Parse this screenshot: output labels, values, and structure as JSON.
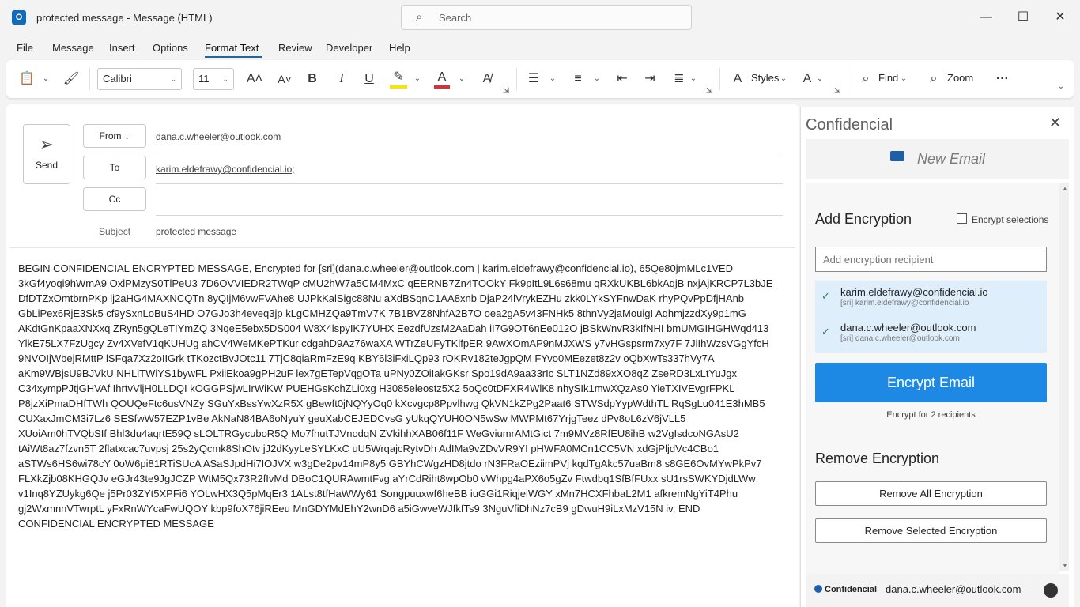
{
  "window": {
    "app_icon": "O",
    "title": "protected message  -  Message (HTML)",
    "search_placeholder": "Search",
    "minimize": "—",
    "maximize": "☐",
    "close": "✕"
  },
  "menu": {
    "items": [
      "File",
      "Message",
      "Insert",
      "Options",
      "Format Text",
      "Review",
      "Developer",
      "Help"
    ],
    "active": "Format Text"
  },
  "ribbon": {
    "font_name": "Calibri",
    "font_size": "11",
    "styles_label": "Styles",
    "find_label": "Find",
    "zoom_label": "Zoom",
    "more_label": "···"
  },
  "compose": {
    "send_label": "Send",
    "from_label": "From",
    "from_value": "dana.c.wheeler@outlook.com",
    "to_label": "To",
    "to_value": "karim.eldefrawy@confidencial.io;",
    "cc_label": "Cc",
    "cc_value": "",
    "subject_label": "Subject",
    "subject_value": "protected message",
    "body": "BEGIN CONFIDENCIAL ENCRYPTED MESSAGE, Encrypted for [sri](dana.c.wheeler@outlook.com | karim.eldefrawy@confidencial.io), 65Qe80jmMLc1VED 3kGf4yoqi9hWmA9 OxlPMzyS0TlPeU3 7D6OVVIEDR2TWqP cMU2hW7a5CM4MxC qEERNB7Zn4TOOkY Fk9pItL9L6s68mu qRXkUKBL6bkAqjB nxjAjKRCP7L3bJE DfDTZxOmtbrnPKp lj2aHG4MAXNCQTn 8yQIjM6vwFVAhe8 UJPkKalSigc88Nu aXdBSqnC1AA8xnb DjaP24lVrykEZHu zkk0LYkSYFnwDaK rhyPQvPpDfjHAnb GbLiPex6RjE3Sk5 cf9ySxnLoBuS4HD O7GJo3h4eveq3jp kLgCMHZQa9TmV7K 7B1BVZ8NhfA2B7O oea2gA5v43FNHk5 8thnVy2jaMouigI AqhmjzzdXy9p1mG AKdtGnKpaaXNXxq ZRyn5gQLeTIYmZQ 3NqeE5ebx5DS004 W8X4lspyIK7YUHX EezdfUzsM2AaDah iI7G9OT6nEe012O jBSkWnvR3kIfNHI bmUMGIHGHWqd413 YlkE75LX7FzUgcy Zv4XVefV1qKUHUg ahCV4WeMKePTKur cdgahD9Az76waXA WTrZeUFyTKlfpER 9AwXOmAP9nMJXWS y7vHGspsrm7xy7F 7JiIhWzsVGgYfcH 9NVOIjWbejRMttP lSFqa7Xz2oIIGrk tTKozctBvJOtc11 7TjC8qiaRmFzE9q KBY6l3iFxiLQp93 rOKRv182teJgpQM FYvo0MEezet8z2v oQbXwTs337hVy7A aKm9WBjsU9BJVkU NHLiTWiYS1bywFL PxiiEkoa9gPH2uF lex7gETepVqgOTa uPNy0ZOiIakGKsr Spo19dA9aa33rIc SLT1NZd89xXO8qZ ZseRD3LxLtYuJgx C34xympPJtjGHVAf IhrtvVljH0LLDQI kOGGPSjwLIrWiKW PUEHGsKchZLi0xg H3085eleostz5X2 5oQc0tDFXR4WlK8 nhySIk1mwXQzAs0 YieTXIVEvgrFPKL P8jzXiPmaDHfTWh QOUQeFtc6usVNZy SGuYxBssYwXzR5X gBewft0jNQYyOq0 kXcvgcp8Ppvlhwg QkVN1kZPg2Paat6 STWSdpYypWdthTL RqSgLu041E3hMB5 CUXaxJmCM3i7Lz6 SESfwW57EZP1vBe AkNaN84BA6oNyuY geuXabCEJEDCvsG yUkqQYUH0ON5wSw MWPMt67YrjgTeez dPv8oL6zV6jVLL5 XUoiAm0hTVQbSIf Bhl3du4aqrtE59Q sLOLTRGycuboR5Q Mo7fhutTJVnodqN ZVkihhXAB06f11F WeGviumrAMtGict 7m9MVz8RfEU8ihB w2VgIsdcoNGAsU2 tAiWt8az7fzvn5T 2flatxcac7uvpsj 25s2yQcmk8ShOtv jJ2dKyyLeSYLKxC uU5WrqajcRytvDh AdIMa9vZDvVR9YI pHWFA0MCn1CC5VN xdGjPljdVc4CBo1 aSTWs6HS6wi78cY 0oW6pi81RTiSUcA ASaSJpdHi7IOJVX w3gDe2pv14mP8y5 GBYhCWgzHD8jtdo rN3FRaOEziimPVj kqdTgAkc57uaBm8 s8GE6OvMYwPkPv7 FLXkZjb08KHGQJv eGJr43te9JgJCZP WtM5Qx73R2fIvMd DBoC1QURAwmtFvg aYrCdRiht8wpOb0 vWhpg4aPX6o5gZv Ftwdbq1SfBfFUxx sU1rsSWKYDjdLWw v1Inq8YZUykg6Qe j5Pr03ZYt5XPFi6 YOLwHX3Q5pMqEr3 1ALst8tfHaWWy61 Songpuuxwf6heBB iuGGi1RiqjeiWGY xMn7HCXFhbaL2M1 afkremNgYiT4Phu gj2WxmnnVTwrptL yFxRnWYcaFwUQOY kbp9foX76jiREeu MnGDYMdEhY2wnD6 a5iGwveWJfkfTs9 3NguVfiDhNz7cB9 gDwuH9iLxMzV15N iv, END CONFIDENCIAL ENCRYPTED MESSAGE"
  },
  "panel": {
    "title": "Confidencial",
    "close": "✕",
    "new_email_label": "New Email",
    "add_heading": "Add Encryption",
    "encrypt_selections_label": "Encrypt selections",
    "recipient_placeholder": "Add encryption recipient",
    "recipients": [
      {
        "email": "karim.eldefrawy@confidencial.io",
        "sri": "[sri] karim.eldefrawy@confidencial.io"
      },
      {
        "email": "dana.c.wheeler@outlook.com",
        "sri": "[sri] dana.c.wheeler@outlook.com"
      }
    ],
    "encrypt_button": "Encrypt Email",
    "encrypt_sub": "Encrypt for 2 recipients",
    "remove_heading": "Remove Encryption",
    "remove_all": "Remove All Encryption",
    "remove_selected": "Remove Selected Encryption",
    "footer_logo": "Confidencial",
    "footer_email": "dana.c.wheeler@outlook.com"
  },
  "colors": {
    "accent": "#0f6cbd",
    "encrypt_button": "#1e88e5",
    "recipient_bg": "#dfeefb"
  }
}
